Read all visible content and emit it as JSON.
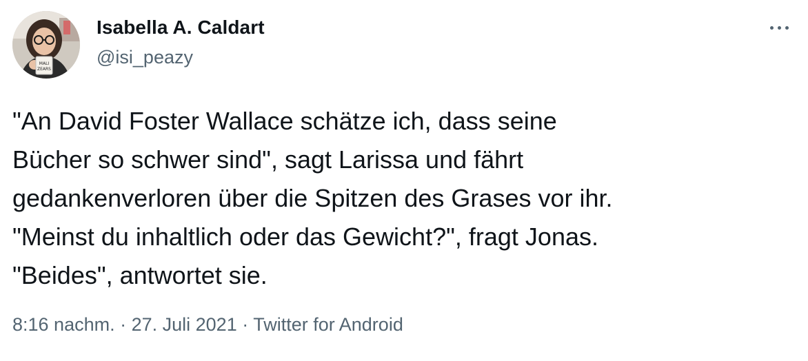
{
  "author": {
    "display_name": "Isabella A. Caldart",
    "handle": "@isi_peazy",
    "avatar_icon": "profile-photo-icon",
    "mug_text": "MALI ZEARS"
  },
  "more_menu": {
    "icon": "more-options-icon"
  },
  "tweet": {
    "lines": [
      "\"An David Foster Wallace schätze ich, dass seine",
      "Bücher so schwer sind\", sagt Larissa und fährt",
      "gedankenverloren über die Spitzen des Grases vor ihr.",
      "\"Meinst du inhaltlich oder das Gewicht?\", fragt Jonas.",
      "\"Beides\", antwortet sie."
    ]
  },
  "meta": {
    "time": "8:16 nachm.",
    "separator": " · ",
    "date": "27. Juli 2021",
    "source": "Twitter for Android"
  },
  "colors": {
    "text_primary": "#0f1419",
    "text_secondary": "#536471",
    "background": "#ffffff"
  }
}
